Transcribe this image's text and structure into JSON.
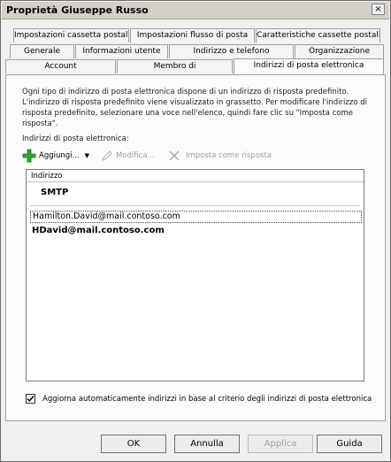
{
  "window": {
    "title": "Proprietà Giuseppe Russo",
    "close_label": "×"
  },
  "tabs": {
    "row1": [
      "Impostazioni cassetta postale",
      "Impostazioni flusso di posta",
      "Caratteristiche cassette postali"
    ],
    "row2": [
      "Generale",
      "Informazioni utente",
      "Indirizzo e telefono",
      "Organizzazione"
    ],
    "row3": [
      "Account",
      "Membro di",
      "Indirizzi di posta elettronica"
    ],
    "active": "Indirizzi di posta elettronica"
  },
  "panel": {
    "description": "Ogni tipo di indirizzo di posta elettronica dispone di un indirizzo di risposta predefinito. L'indirizzo di risposta predefinito viene visualizzato in grassetto. Per modificare l'indirizzo di risposta predefinito, selezionare una voce nell'elenco, quindi fare clic su \"Imposta come risposta\".",
    "list_label": "Indirizzi di posta elettronica:",
    "toolbar": {
      "add": "Aggiungi...",
      "edit": "Modifica...",
      "set_reply": "Imposta come risposta"
    },
    "list": {
      "column_header": "Indirizzo",
      "group": "SMTP",
      "rows": [
        "Hamilton.David@mail.contoso.com",
        "HDavid@mail.contoso.com"
      ]
    },
    "auto_update": {
      "checked": true,
      "label": "Aggiorna automaticamente indirizzi in base al criterio degli indirizzi di posta elettronica"
    }
  },
  "buttons": {
    "ok": "OK",
    "cancel": "Annulla",
    "apply": "Applica",
    "help": "Guida"
  }
}
